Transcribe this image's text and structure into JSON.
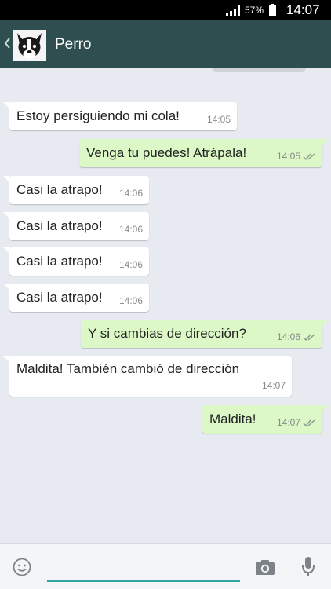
{
  "status_bar": {
    "battery_percent": "57%",
    "clock": "14:07",
    "signal_icon": "signal-bars-icon",
    "battery_icon": "battery-icon"
  },
  "header": {
    "contact_name": "Perro",
    "back_icon": "chevron-left-icon",
    "avatar_icon": "dog-avatar",
    "background_color": "#2e4e4f"
  },
  "messages": [
    {
      "direction": "incoming",
      "text": "Estoy persiguiendo mi cola!",
      "time": "14:05"
    },
    {
      "direction": "outgoing",
      "text": "Venga tu puedes! Atrápala!",
      "time": "14:05",
      "status_icon": "double-check-icon"
    },
    {
      "direction": "incoming",
      "text": "Casi la atrapo!",
      "time": "14:06"
    },
    {
      "direction": "incoming",
      "text": "Casi la atrapo!",
      "time": "14:06"
    },
    {
      "direction": "incoming",
      "text": "Casi la atrapo!",
      "time": "14:06"
    },
    {
      "direction": "incoming",
      "text": "Casi la atrapo!",
      "time": "14:06"
    },
    {
      "direction": "outgoing",
      "text": "Y si cambias de dirección?",
      "time": "14:06",
      "status_icon": "double-check-icon"
    },
    {
      "direction": "incoming",
      "text": "Maldita! También cambió de dirección",
      "time": "14:07"
    },
    {
      "direction": "outgoing",
      "text": "Maldita!",
      "time": "14:07",
      "status_icon": "double-check-icon"
    }
  ],
  "input_bar": {
    "message_value": "",
    "emoji_icon": "smiley-icon",
    "camera_icon": "camera-icon",
    "mic_icon": "microphone-icon",
    "accent_color": "#34a7a4"
  },
  "colors": {
    "incoming_bubble": "#ffffff",
    "outgoing_bubble": "#dcf8c6",
    "chat_background": "#e7eaf0"
  }
}
